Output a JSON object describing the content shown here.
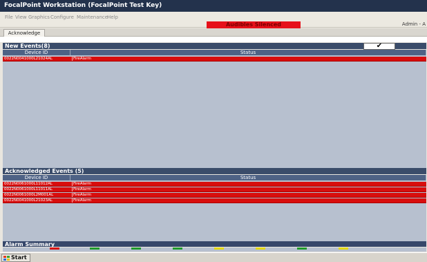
{
  "window": {
    "title": "FocalPoint Workstation (FocalPoint Test Key)"
  },
  "menu": {
    "items": [
      "File",
      "View",
      "Graphics",
      "Configure",
      "Maintenance",
      "Help"
    ]
  },
  "banner": {
    "text": "Audibles Silenced",
    "color": "#e6101a"
  },
  "user": {
    "label": "Admin - A"
  },
  "tabs": [
    {
      "label": "Acknowledge"
    }
  ],
  "new_events": {
    "header": "New Events(8)",
    "ack_icon": "check-icon",
    "columns": {
      "device": "Device ID",
      "status": "Status"
    },
    "rows": [
      {
        "device": "0022N0041000L21024AL",
        "status": "FireAlarm"
      }
    ]
  },
  "acknowledged_events": {
    "header": "Acknowledged Events (5)",
    "columns": {
      "device": "Device ID",
      "status": "Status"
    },
    "rows": [
      {
        "device": "0022N0061000L11012AL",
        "status": "FireAlarm"
      },
      {
        "device": "0022N0061000L11011AL",
        "status": "FireAlarm"
      },
      {
        "device": "0022N0061000L2M001AL",
        "status": "FireAlarm"
      },
      {
        "device": "0022N0041000L21023AL",
        "status": "FireAlarm"
      }
    ]
  },
  "alarm_summary": {
    "header": "Alarm Summary",
    "swatch_colors": [
      "#d80d0d",
      "#1f9a2a",
      "#1f9a2a",
      "#1f9a2a",
      "#e4d80c",
      "#e4d80c",
      "#1f9a2a",
      "#e4d80c"
    ]
  },
  "taskbar": {
    "start_label": "Start",
    "start_icon": "windows-logo-icon"
  },
  "colors": {
    "alarm_row": "#d80d0d",
    "header_bar": "#3a4c6a",
    "grid_background": "#b7c0cf"
  }
}
